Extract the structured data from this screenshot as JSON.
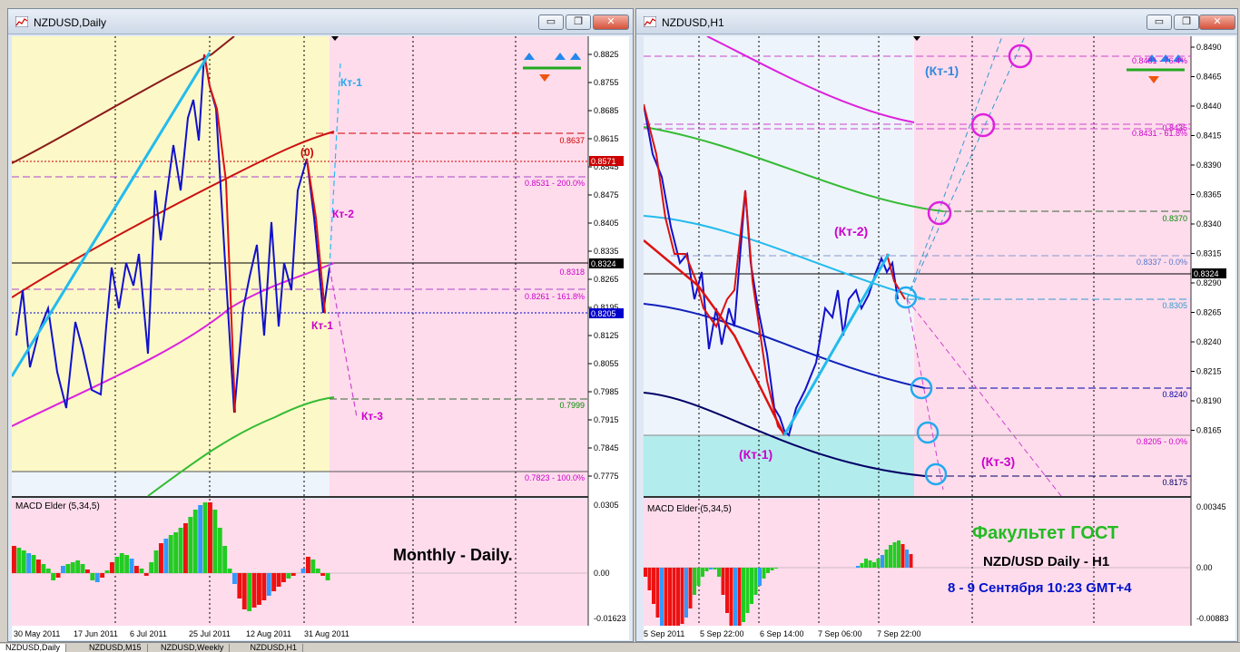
{
  "left_window": {
    "title": "NZDUSD,Daily",
    "price_ticks": [
      "0.8825",
      "0.8755",
      "0.8685",
      "0.8615",
      "0.8545",
      "0.8475",
      "0.8405",
      "0.8335",
      "0.8265",
      "0.8195",
      "0.8125",
      "0.8055",
      "0.7985",
      "0.7915",
      "0.7845",
      "0.7775"
    ],
    "price_labels": [
      {
        "text": "0.8637",
        "color": "#cc0000"
      },
      {
        "text": "0.8571",
        "color": "#ffffff",
        "bg": "#cc0000"
      },
      {
        "text": "0.8531 - 200.0%",
        "color": "#cc00cc"
      },
      {
        "text": "0.8324",
        "color": "#ffffff",
        "bg": "#000000"
      },
      {
        "text": "0.8318",
        "color": "#cc00cc"
      },
      {
        "text": "0.8261 - 161.8%",
        "color": "#cc00cc"
      },
      {
        "text": "0.8205",
        "color": "#ffffff",
        "bg": "#0000cc"
      },
      {
        "text": "0.7999",
        "color": "#008800"
      },
      {
        "text": "0.7823 - 100.0%",
        "color": "#cc00cc"
      }
    ],
    "annotations": {
      "kt1_top": "Кт-1",
      "kt2": "Кт-2",
      "kt1_bottom": "Кт-1",
      "kt3": "Кт-3",
      "zero": "(0)"
    },
    "macd_label": "MACD Elder (5,34,5)",
    "macd_ticks": [
      "0.0305",
      "0.00",
      "-0.01623"
    ],
    "caption": "Monthly - Daily.",
    "date_ticks": [
      "30 May 2011",
      "17 Jun 2011",
      "6 Jul 2011",
      "25 Jul 2011",
      "12 Aug 2011",
      "31 Aug 2011"
    ]
  },
  "right_window": {
    "title": "NZDUSD,H1",
    "price_ticks": [
      "0.8490",
      "0.8465",
      "0.8440",
      "0.8415",
      "0.8390",
      "0.8365",
      "0.8340",
      "0.8315",
      "0.8290",
      "0.8265",
      "0.8240",
      "0.8215",
      "0.8190",
      "0.8165"
    ],
    "price_labels": [
      {
        "text": "0.8481 - 76.4%",
        "color": "#cc00cc"
      },
      {
        "text": "0.8435",
        "color": "#cc00cc"
      },
      {
        "text": "0.8431 - 61.8%",
        "color": "#cc00cc"
      },
      {
        "text": "0.8370",
        "color": "#008800"
      },
      {
        "text": "0.8337 - 0.0%",
        "color": "#5577cc"
      },
      {
        "text": "0.8324",
        "color": "#ffffff",
        "bg": "#000000"
      },
      {
        "text": "0.8305",
        "color": "#3399cc"
      },
      {
        "text": "0.8240",
        "color": "#0000aa"
      },
      {
        "text": "0.8205 - 0.0%",
        "color": "#cc00cc"
      },
      {
        "text": "0.8175",
        "color": "#000066"
      }
    ],
    "annotations": {
      "kt1_top": "(Кт-1)",
      "kt2": "(Кт-2)",
      "kt1_bottom": "(Кт-1)",
      "kt3": "(Кт-3)"
    },
    "macd_label": "MACD Elder (5,34,5)",
    "macd_ticks": [
      "0.00345",
      "0.00",
      "-0.00883"
    ],
    "caption_line1": "Факультет ГОСТ",
    "caption_line2": "NZD/USD Daily - H1",
    "caption_line3": "8 - 9 Сентября 10:23 GMT+4",
    "date_ticks": [
      "5 Sep 2011",
      "5 Sep 22:00",
      "6 Sep 14:00",
      "7 Sep 06:00",
      "7 Sep 22:00"
    ]
  },
  "tabs": [
    "NZDUSD,Daily",
    "NZDUSD,M15",
    "NZDUSD,Weekly",
    "NZDUSD,H1"
  ],
  "window_buttons": {
    "minimize": "▭",
    "restore": "❐",
    "close": "✕"
  },
  "colors": {
    "pink_bg": "#ffdcec",
    "yellow_bg": "#fcf8c8",
    "light_blue_bg": "#eef4fb",
    "teal_zone": "#b3ecec",
    "macd_green": "#22cc22",
    "macd_red": "#ee1111",
    "macd_blue": "#3399ff"
  }
}
